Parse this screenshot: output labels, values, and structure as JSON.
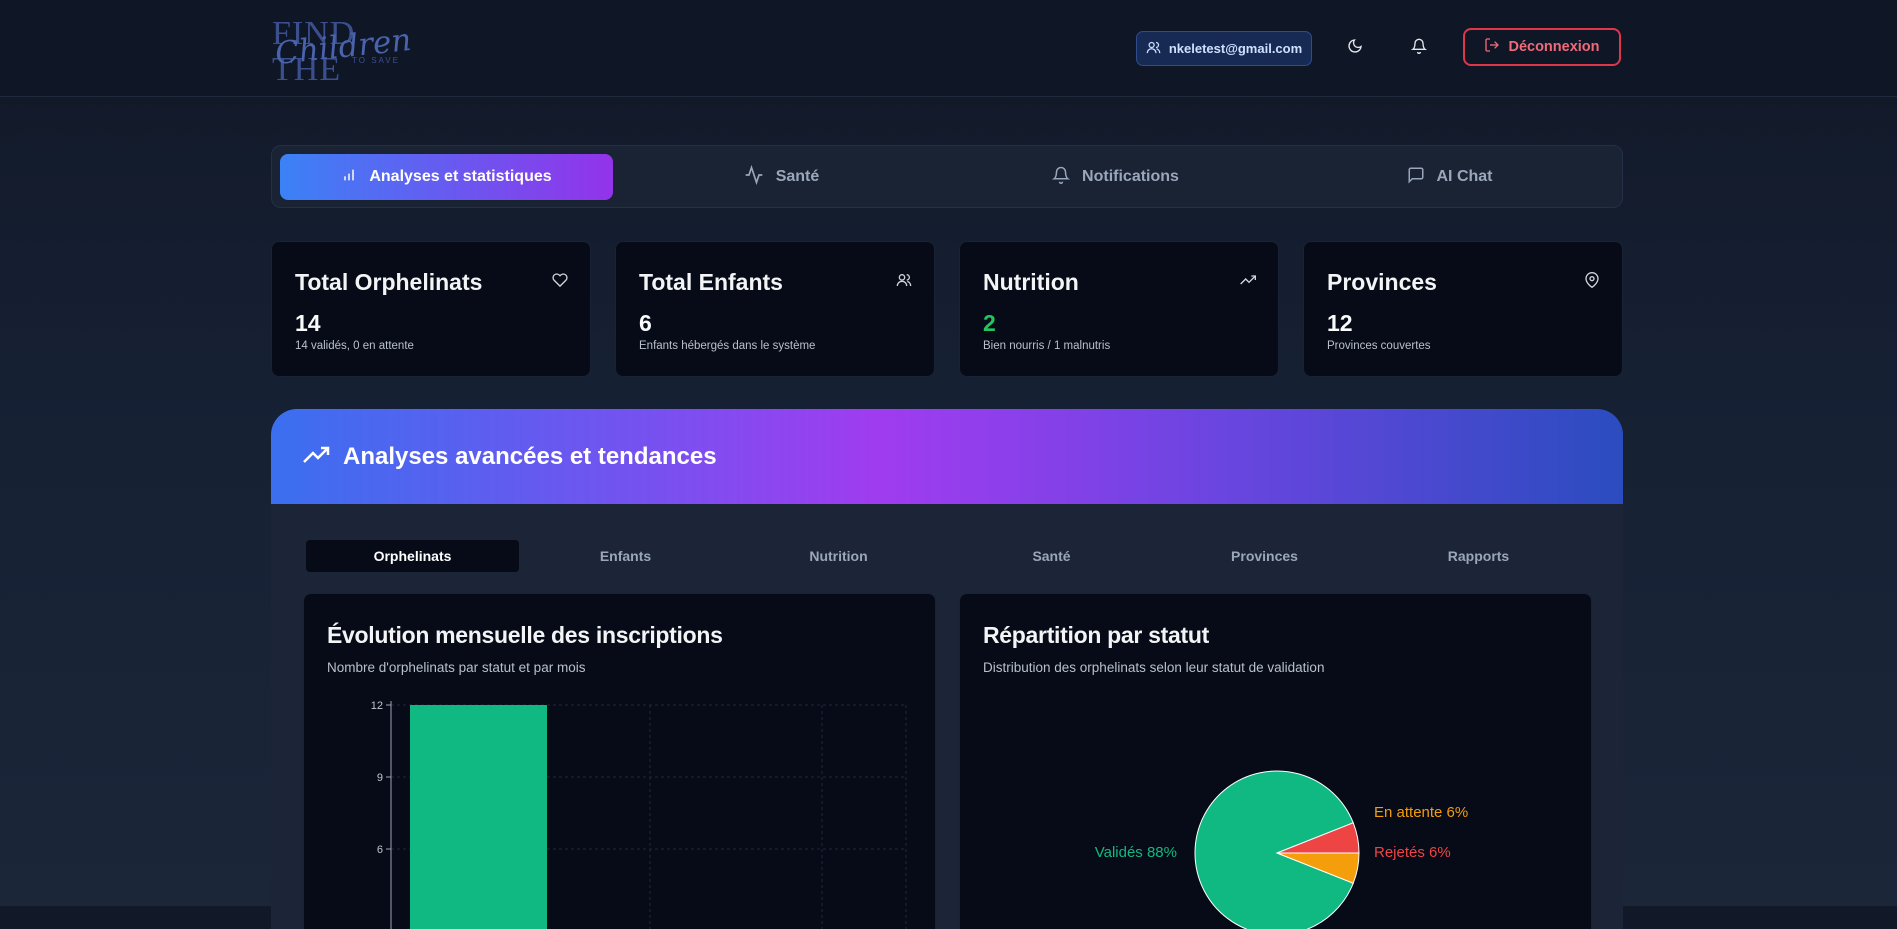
{
  "header": {
    "logo_text_1": "FIND THE",
    "logo_text_2": "Children",
    "logo_text_3": "TO SAVE",
    "user_email": "nkeletest@gmail.com",
    "logout_label": "Déconnexion"
  },
  "tabs": [
    {
      "label": "Analyses et statistiques",
      "icon": "bar-chart-icon"
    },
    {
      "label": "Santé",
      "icon": "activity-icon"
    },
    {
      "label": "Notifications",
      "icon": "bell-icon"
    },
    {
      "label": "AI Chat",
      "icon": "message-icon"
    }
  ],
  "cards": [
    {
      "title": "Total Orphelinats",
      "value": "14",
      "sub": "14 validés, 0 en attente",
      "icon": "heart-icon"
    },
    {
      "title": "Total Enfants",
      "value": "6",
      "sub": "Enfants hébergés dans le système",
      "icon": "users-icon"
    },
    {
      "title": "Nutrition",
      "value": "2",
      "sub": "Bien nourris / 1 malnutris",
      "icon": "trending-up-icon"
    },
    {
      "title": "Provinces",
      "value": "12",
      "sub": "Provinces couvertes",
      "icon": "map-pin-icon"
    }
  ],
  "banner": {
    "title": "Analyses avancées et tendances"
  },
  "subtabs": [
    "Orphelinats",
    "Enfants",
    "Nutrition",
    "Santé",
    "Provinces",
    "Rapports"
  ],
  "chart_left": {
    "title": "Évolution mensuelle des inscriptions",
    "subtitle": "Nombre d'orphelinats par statut et par mois"
  },
  "chart_right": {
    "title": "Répartition par statut",
    "subtitle": "Distribution des orphelinats selon leur statut de validation"
  },
  "colors": {
    "validated": "#10b981",
    "pending": "#f59e0b",
    "rejected": "#ef4444"
  },
  "chart_data": [
    {
      "type": "bar",
      "title": "Évolution mensuelle des inscriptions",
      "yticks": [
        6,
        9,
        12
      ],
      "ylim": [
        0,
        12
      ],
      "values": [
        12
      ],
      "grid": true
    },
    {
      "type": "pie",
      "title": "Répartition par statut",
      "slices": [
        {
          "label": "Validés 88%",
          "value": 88,
          "color": "#10b981"
        },
        {
          "label": "En attente 6%",
          "value": 6,
          "color": "#f59e0b"
        },
        {
          "label": "Rejetés 6%",
          "value": 6,
          "color": "#ef4444"
        }
      ]
    }
  ]
}
